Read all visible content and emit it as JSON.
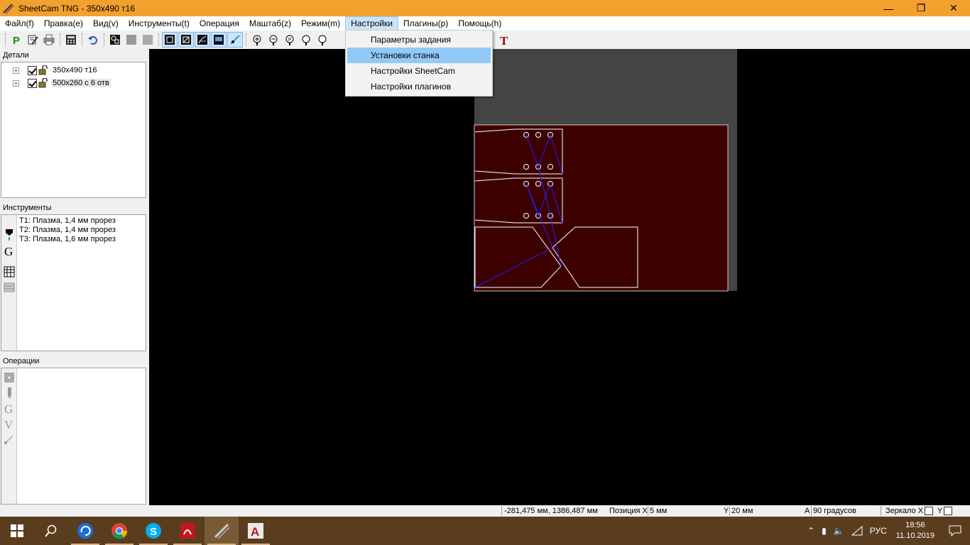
{
  "window": {
    "title": "SheetCam TNG - 350x490 т16",
    "controls": [
      "minimize",
      "maximize",
      "close"
    ]
  },
  "menubar": {
    "items": [
      {
        "label": "Файл(f)"
      },
      {
        "label": "Правка(e)"
      },
      {
        "label": "Вид(v)"
      },
      {
        "label": "Инструменты(t)"
      },
      {
        "label": "Операция"
      },
      {
        "label": "Маштаб(z)"
      },
      {
        "label": "Режим(m)"
      },
      {
        "label": "Настройки",
        "active": true
      },
      {
        "label": "Плагины(p)"
      },
      {
        "label": "Помощь(h)"
      }
    ]
  },
  "dropdown": {
    "items": [
      {
        "label": "Параметры задания"
      },
      {
        "label": "Установки станка",
        "highlighted": true
      },
      {
        "label": "Настройки SheetCam"
      },
      {
        "label": "Настройки плагинов"
      }
    ]
  },
  "panels": {
    "parts": {
      "title": "Детали",
      "items": [
        {
          "label": "350x490 т16",
          "checked": true
        },
        {
          "label": "500x260 с 6 отв",
          "checked": true,
          "selected": true
        }
      ]
    },
    "tools": {
      "title": "Инструменты",
      "items": [
        {
          "label": "T1: Плазма, 1,4 мм прорез"
        },
        {
          "label": "T2: Плазма, 1,4 мм прорез"
        },
        {
          "label": "T3: Плазма, 1,6 мм прорез"
        }
      ]
    },
    "operations": {
      "title": "Операции",
      "items": []
    }
  },
  "statusbar": {
    "coords": "-281,475 мм, 1386,487 мм",
    "pos_x_label": "Позиция X",
    "pos_x_value": "5 мм",
    "y_label": "Y",
    "y_value": "20 мм",
    "a_label": "A",
    "a_value": "90 градусов",
    "mirror_label": "Зеркало X",
    "mirror_y_label": "Y"
  },
  "taskbar": {
    "apps": [
      "start-icon",
      "search-icon",
      "sync-app-icon",
      "chrome-icon",
      "skype-icon",
      "pdf-icon",
      "sheetcam-icon",
      "autocad-icon"
    ],
    "language": "РУС",
    "time": "18:56",
    "date": "11.10.2019"
  },
  "colors": {
    "titlebar": "#f2a02e",
    "sheet": "#3d0000",
    "canvas_bg": "#000000",
    "toolpath": "#2020ff",
    "menu_highlight": "#91c9f7"
  }
}
